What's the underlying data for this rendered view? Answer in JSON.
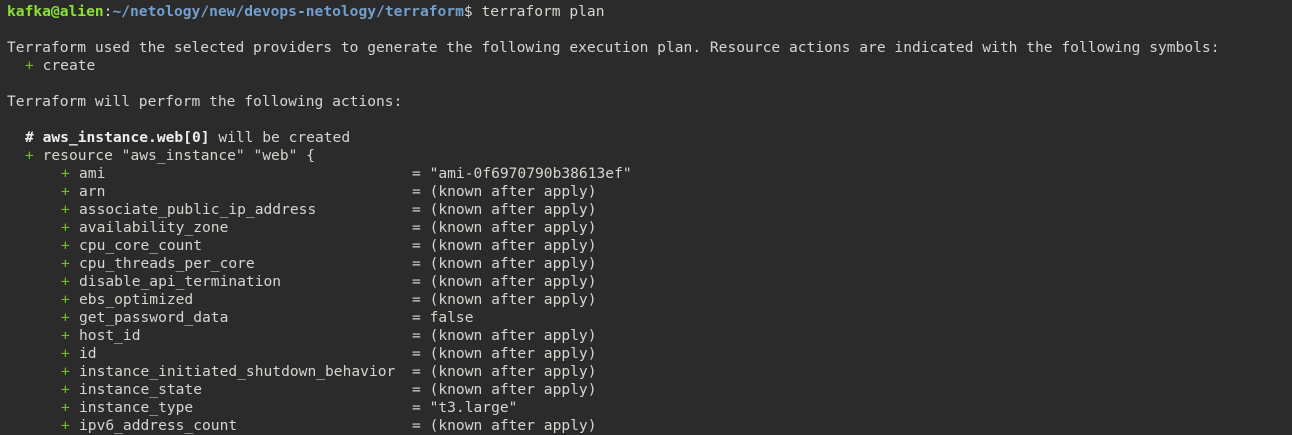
{
  "prompt": {
    "user_host": "kafka@alien",
    "colon": ":",
    "path": "~/netology/new/devops-netology/terraform",
    "dollar": "$",
    "command": " terraform plan"
  },
  "plan": {
    "intro": "Terraform used the selected providers to generate the following execution plan. Resource actions are indicated with the following symbols:",
    "symbol_plus": "+",
    "symbol_label": "create",
    "actions_heading": "Terraform will perform the following actions:",
    "comment_hash": "#",
    "resource_addr": "aws_instance.web[0]",
    "resource_suffix": " will be created",
    "resource_plus": "+",
    "resource_decl": "resource \"aws_instance\" \"web\" {"
  },
  "attributes": [
    {
      "plus": "+",
      "name": "ami",
      "value": "= \"ami-0f6970790b38613ef\""
    },
    {
      "plus": "+",
      "name": "arn",
      "value": "= (known after apply)"
    },
    {
      "plus": "+",
      "name": "associate_public_ip_address",
      "value": "= (known after apply)"
    },
    {
      "plus": "+",
      "name": "availability_zone",
      "value": "= (known after apply)"
    },
    {
      "plus": "+",
      "name": "cpu_core_count",
      "value": "= (known after apply)"
    },
    {
      "plus": "+",
      "name": "cpu_threads_per_core",
      "value": "= (known after apply)"
    },
    {
      "plus": "+",
      "name": "disable_api_termination",
      "value": "= (known after apply)"
    },
    {
      "plus": "+",
      "name": "ebs_optimized",
      "value": "= (known after apply)"
    },
    {
      "plus": "+",
      "name": "get_password_data",
      "value": "= false"
    },
    {
      "plus": "+",
      "name": "host_id",
      "value": "= (known after apply)"
    },
    {
      "plus": "+",
      "name": "id",
      "value": "= (known after apply)"
    },
    {
      "plus": "+",
      "name": "instance_initiated_shutdown_behavior",
      "value": "= (known after apply)"
    },
    {
      "plus": "+",
      "name": "instance_state",
      "value": "= (known after apply)"
    },
    {
      "plus": "+",
      "name": "instance_type",
      "value": "= \"t3.large\""
    },
    {
      "plus": "+",
      "name": "ipv6_address_count",
      "value": "= (known after apply)"
    }
  ]
}
